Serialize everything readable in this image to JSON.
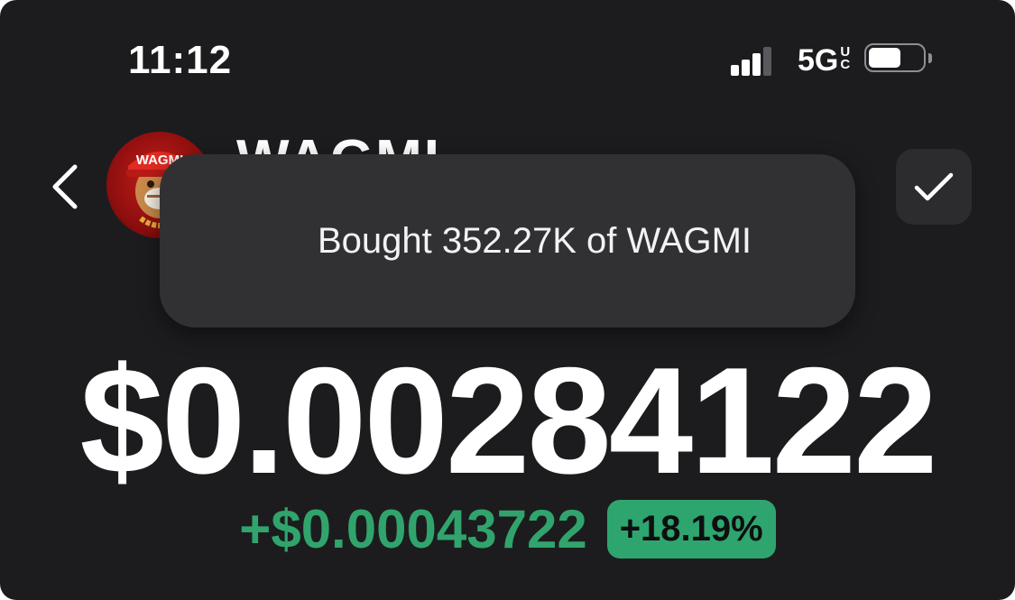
{
  "status_bar": {
    "time": "11:12",
    "network_main": "5G",
    "network_sub_1": "U",
    "network_sub_2": "C",
    "signal_bars_active": 3,
    "signal_bars_total": 4,
    "battery_level": 0.6,
    "icons": [
      "signal-icon",
      "battery-icon"
    ]
  },
  "header": {
    "back_icon": "chevron-left-icon",
    "token_name": "WAGMI",
    "avatar_cap_text": "WAGMI",
    "done_icon": "checkmark-icon"
  },
  "toast": {
    "message": "Bought 352.27K of WAGMI"
  },
  "price": {
    "value": "$0.00284122",
    "change_amount": "+$0.00043722",
    "change_percent": "+18.19%"
  },
  "colors": {
    "background": "#1c1c1e",
    "toast_background": "#313133",
    "positive": "#30a46c",
    "badge": "#2ea56e",
    "text": "#ffffff"
  }
}
